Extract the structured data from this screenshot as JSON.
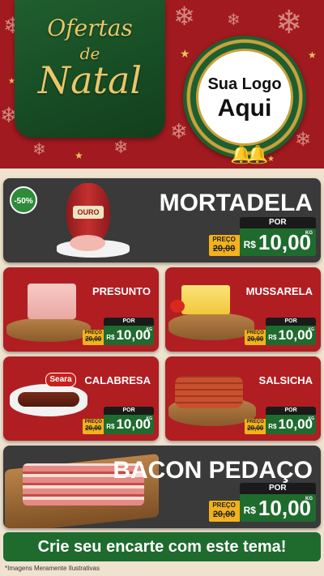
{
  "header": {
    "title_line1": "Ofertas",
    "title_line2": "de",
    "title_line3": "Natal",
    "logo_line1": "Sua Logo",
    "logo_line2": "Aqui"
  },
  "products": {
    "mortadela": {
      "name": "MORTADELA",
      "discount": "-50%",
      "brand": "OURO",
      "old_label": "PREÇO",
      "old_price": "20,00",
      "por": "POR",
      "currency": "R$",
      "price": "10,00",
      "unit": "KG"
    },
    "presunto": {
      "name": "PRESUNTO",
      "old_label": "PREÇO",
      "old_price": "20,00",
      "por": "POR",
      "currency": "R$",
      "price": "10,00",
      "unit": "KG"
    },
    "mussarela": {
      "name": "MUSSARELA",
      "old_label": "PREÇO",
      "old_price": "20,00",
      "por": "POR",
      "currency": "R$",
      "price": "10,00",
      "unit": "KG"
    },
    "calabresa": {
      "name": "CALABRESA",
      "brand": "Seara",
      "old_label": "PREÇO",
      "old_price": "20,00",
      "por": "POR",
      "currency": "R$",
      "price": "10,00",
      "unit": "KG"
    },
    "salsicha": {
      "name": "SALSICHA",
      "old_label": "PREÇO",
      "old_price": "20,00",
      "por": "POR",
      "currency": "R$",
      "price": "10,00",
      "unit": "KG"
    },
    "bacon": {
      "name": "BACON PEDAÇO",
      "old_label": "PREÇO",
      "old_price": "20,00",
      "por": "POR",
      "currency": "R$",
      "price": "10,00",
      "unit": "KG"
    }
  },
  "cta": "Crie seu encarte com este tema!",
  "footer": "*Imagens Meramente Ilustrativas"
}
